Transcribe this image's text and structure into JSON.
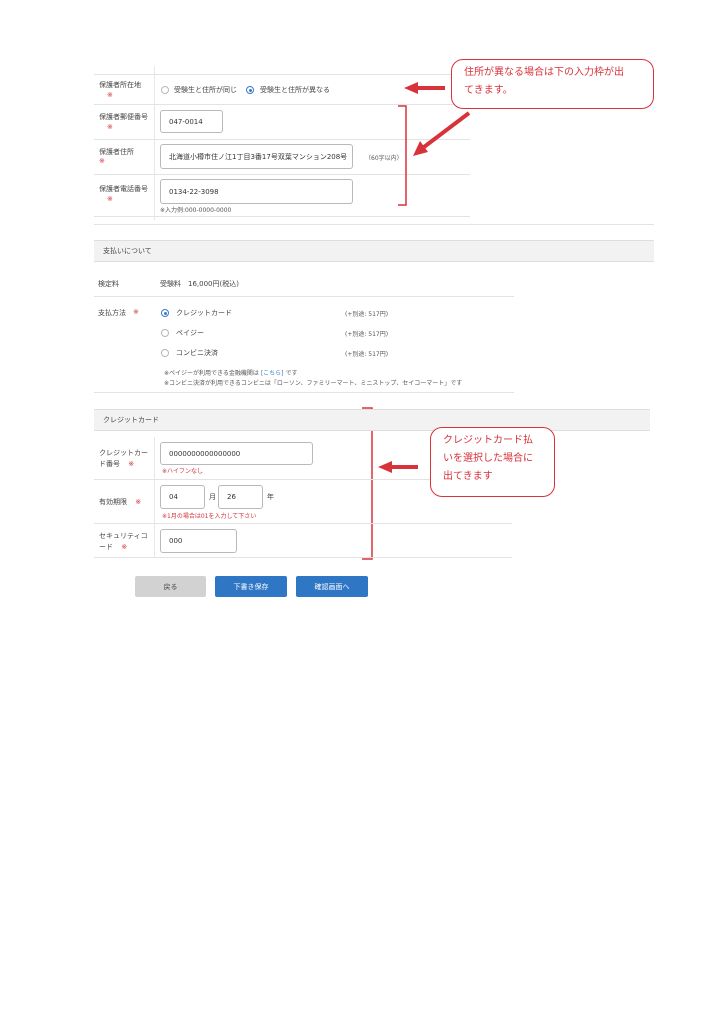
{
  "guardian": {
    "address_type": {
      "label": "保護者所在地",
      "required": "※",
      "options": [
        "受験生と住所が同じ",
        "受験生と住所が異なる"
      ]
    },
    "postal": {
      "label": "保護者郵便番号",
      "required": "※",
      "value": "047-0014"
    },
    "address": {
      "label": "保護者住所",
      "required": "※",
      "value": "北海道小樽市住ノ江1丁目3番17号双葉マンション208号",
      "hint": "（60字以内）"
    },
    "phone": {
      "label": "保護者電話番号",
      "required": "※",
      "value": "0134-22-3098",
      "example": "※入力例:000-0000-0000"
    }
  },
  "callouts": {
    "address": {
      "lines": [
        "住所が異なる場合は下の入力枠が出",
        "てきます。"
      ]
    },
    "credit": {
      "lines": [
        "クレジットカード払",
        "いを選択した場合に",
        "出てきます"
      ]
    }
  },
  "payment": {
    "section_title": "支払いについて",
    "fee": {
      "label": "検定料",
      "value": "受験料　16,000円(税込)"
    },
    "method": {
      "label": "支払方法",
      "required": "※",
      "options": [
        {
          "label": "クレジットカード",
          "fee": "(+別途: 517円)"
        },
        {
          "label": "ペイジー",
          "fee": "(+別途: 517円)"
        },
        {
          "label": "コンビニ決済",
          "fee": "(+別途: 517円)"
        }
      ],
      "note1_prefix": "※ペイジーが利用できる金融機関は",
      "note1_link": "[こちら]",
      "note1_suffix": "です",
      "note2": "※コンビニ決済が利用できるコンビニは「ローソン、ファミリーマート、ミニストップ、セイコーマート」です"
    }
  },
  "credit": {
    "section_title": "クレジットカード",
    "number": {
      "label_line1": "クレジットカー",
      "label_line2": "ド番号",
      "required": "※",
      "value": "0000000000000000",
      "note": "※ハイフンなし"
    },
    "expiry": {
      "label": "有効期限",
      "required": "※",
      "month": "04",
      "month_unit": "月",
      "year": "26",
      "year_unit": "年",
      "note": "※1月の場合は01を入力して下さい"
    },
    "security": {
      "label_line1": "セキュリティコ",
      "label_line2": "ード",
      "required": "※",
      "value": "000"
    }
  },
  "buttons": {
    "back": "戻る",
    "draft": "下書き保存",
    "confirm": "確認画面へ"
  },
  "colors": {
    "accent": "#3a7bc8",
    "annotation": "#d8323a",
    "button_blue": "#2f77c4",
    "button_gray": "#d2d2d2"
  }
}
